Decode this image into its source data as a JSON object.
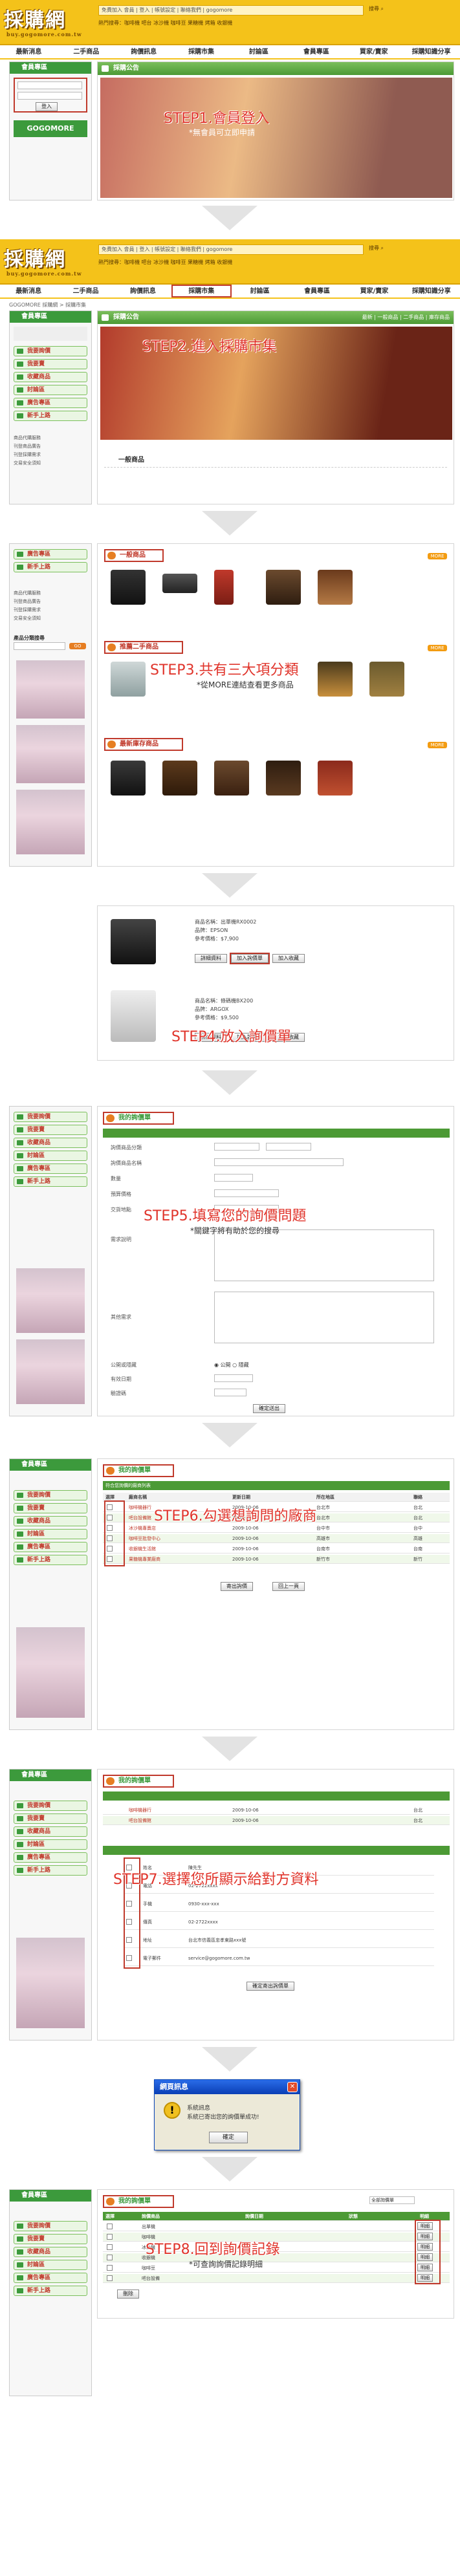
{
  "site": {
    "logo": "採購網",
    "logo_sub": "buy.gogomore.com.tw",
    "top_bar": "免費加入 會員 | 登入 | 帳號設定 | 聯絡我們 | gogomore",
    "top_links": "熱門搜尋：咖啡機 吧台 冰沙機 咖啡豆 果糖機 烤箱 收銀機",
    "search_label": "搜尋",
    "login_label": "登入",
    "register_label": "加入會員"
  },
  "nav": [
    "最新消息",
    "二手商品",
    "詢價訊息",
    "採購市集",
    "討論區",
    "會員專區",
    "買家/賣家",
    "採購知識分享"
  ],
  "sidebar": {
    "member_title": "會員專區",
    "items": [
      "我要詢價",
      "我要賣",
      "收藏商品",
      "討論區",
      "廣告專區",
      "新手上路"
    ],
    "links": [
      "商品代購服務",
      "刊登商品廣告",
      "刊登採購需求",
      "交易安全須知"
    ],
    "search_box_label": "產品分類搜尋",
    "search_go": "GO",
    "gogomore_banner": "GOGOMORE"
  },
  "step1": {
    "title": "STEP1.會員登入",
    "note": "*無會員可立即申請",
    "banner_title": "採購公告"
  },
  "step2": {
    "title": "STEP2.進入採購市集",
    "breadcrumb": "GOGOMORE 採購網 > 採購市集",
    "banner_title": "採購公告",
    "section": "一般商品",
    "banner_tabs": "最新 | 一般商品 | 二手商品 | 庫存商品"
  },
  "step3": {
    "title": "STEP3.共有三大項分類",
    "note": "*從MORE連結查看更多商品",
    "sections": [
      "一般商品",
      "推薦二手商品",
      "最新庫存商品"
    ],
    "more": "MORE"
  },
  "step4": {
    "title": "STEP4.放入詢價單",
    "items": [
      {
        "name": "商品名稱：出單機RX0002",
        "brand": "品牌：EPSON",
        "price": "參考價格：$7,900"
      },
      {
        "name": "商品名稱：條碼機BX200",
        "brand": "品牌：ARGOX",
        "price": "參考價格：$9,500"
      }
    ],
    "add_btn": "加入詢價單",
    "fav_btn": "加入收藏",
    "detail_btn": "詳細資料"
  },
  "step5": {
    "title": "STEP5.填寫您的詢價問題",
    "note": "*關鍵字將有助於您的搜尋",
    "panel_title": "我的詢價單",
    "fields": [
      "詢價商品分類",
      "詢價商品名稱",
      "數量",
      "預算價格",
      "交貨地點",
      "需求說明",
      "其他需求",
      "公開或隱藏",
      "有效日期",
      "驗證碼"
    ],
    "submit": "確定送出",
    "visibility_options": [
      "公開",
      "隱藏"
    ]
  },
  "step6": {
    "title": "STEP6.勾選想詢問的廠商",
    "panel_title": "我的詢價單",
    "bar": "符合您詢價的廠商列表",
    "headers": [
      "選擇",
      "廠商名稱",
      "更新日期",
      "所在地區",
      "聯絡"
    ],
    "vendors": [
      {
        "name": "咖啡機器行",
        "date": "2009-10-06",
        "area": "台北市",
        "city": "台北"
      },
      {
        "name": "吧台設備館",
        "date": "2009-10-06",
        "area": "台北市",
        "city": "台北"
      },
      {
        "name": "冰沙機專賣店",
        "date": "2009-10-06",
        "area": "台中市",
        "city": "台中"
      },
      {
        "name": "咖啡豆批發中心",
        "date": "2009-10-06",
        "area": "高雄市",
        "city": "高雄"
      },
      {
        "name": "收銀機生活館",
        "date": "2009-10-06",
        "area": "台南市",
        "city": "台南"
      },
      {
        "name": "果糖機專業廠商",
        "date": "2009-10-06",
        "area": "新竹市",
        "city": "新竹"
      }
    ],
    "send_btn": "寄出詢價",
    "back_btn": "回上一頁"
  },
  "step7": {
    "title": "STEP7.選擇您所顯示給對方資料",
    "panel_title": "我的詢價單",
    "fields": [
      "姓名",
      "電話",
      "手機",
      "傳真",
      "地址",
      "電子郵件"
    ],
    "values": [
      "陳先生",
      "02-2722xxxx",
      "0930-xxx-xxx",
      "02-2722xxxx",
      "台北市信義區忠孝東路xxx號",
      "service@gogomore.com.tw"
    ],
    "submit": "確定寄出詢價單"
  },
  "dialog": {
    "title": "網頁訊息",
    "line1": "系統訊息",
    "line2": "系統已寄出您的詢價單成功!",
    "ok": "確定"
  },
  "step8": {
    "title": "STEP8.回到詢價記錄",
    "note": "*可查詢詢價記錄明細",
    "panel_title": "我的詢價單",
    "filter": "全部詢價單",
    "headers": [
      "選擇",
      "詢價商品",
      "詢價日期",
      "狀態",
      "明細"
    ],
    "rows": [
      "出單機",
      "咖啡機",
      "冰沙機",
      "收銀機",
      "咖啡豆",
      "吧台設備"
    ],
    "detail": "明細",
    "delete_btn": "刪除"
  }
}
